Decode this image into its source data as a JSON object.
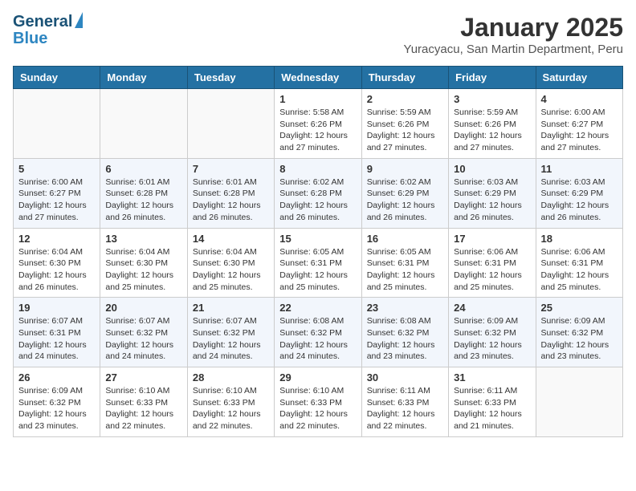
{
  "header": {
    "logo_line1": "General",
    "logo_line2": "Blue",
    "month": "January 2025",
    "location": "Yuracyacu, San Martin Department, Peru"
  },
  "weekdays": [
    "Sunday",
    "Monday",
    "Tuesday",
    "Wednesday",
    "Thursday",
    "Friday",
    "Saturday"
  ],
  "weeks": [
    [
      {
        "day": "",
        "info": ""
      },
      {
        "day": "",
        "info": ""
      },
      {
        "day": "",
        "info": ""
      },
      {
        "day": "1",
        "info": "Sunrise: 5:58 AM\nSunset: 6:26 PM\nDaylight: 12 hours\nand 27 minutes."
      },
      {
        "day": "2",
        "info": "Sunrise: 5:59 AM\nSunset: 6:26 PM\nDaylight: 12 hours\nand 27 minutes."
      },
      {
        "day": "3",
        "info": "Sunrise: 5:59 AM\nSunset: 6:26 PM\nDaylight: 12 hours\nand 27 minutes."
      },
      {
        "day": "4",
        "info": "Sunrise: 6:00 AM\nSunset: 6:27 PM\nDaylight: 12 hours\nand 27 minutes."
      }
    ],
    [
      {
        "day": "5",
        "info": "Sunrise: 6:00 AM\nSunset: 6:27 PM\nDaylight: 12 hours\nand 27 minutes."
      },
      {
        "day": "6",
        "info": "Sunrise: 6:01 AM\nSunset: 6:28 PM\nDaylight: 12 hours\nand 26 minutes."
      },
      {
        "day": "7",
        "info": "Sunrise: 6:01 AM\nSunset: 6:28 PM\nDaylight: 12 hours\nand 26 minutes."
      },
      {
        "day": "8",
        "info": "Sunrise: 6:02 AM\nSunset: 6:28 PM\nDaylight: 12 hours\nand 26 minutes."
      },
      {
        "day": "9",
        "info": "Sunrise: 6:02 AM\nSunset: 6:29 PM\nDaylight: 12 hours\nand 26 minutes."
      },
      {
        "day": "10",
        "info": "Sunrise: 6:03 AM\nSunset: 6:29 PM\nDaylight: 12 hours\nand 26 minutes."
      },
      {
        "day": "11",
        "info": "Sunrise: 6:03 AM\nSunset: 6:29 PM\nDaylight: 12 hours\nand 26 minutes."
      }
    ],
    [
      {
        "day": "12",
        "info": "Sunrise: 6:04 AM\nSunset: 6:30 PM\nDaylight: 12 hours\nand 26 minutes."
      },
      {
        "day": "13",
        "info": "Sunrise: 6:04 AM\nSunset: 6:30 PM\nDaylight: 12 hours\nand 25 minutes."
      },
      {
        "day": "14",
        "info": "Sunrise: 6:04 AM\nSunset: 6:30 PM\nDaylight: 12 hours\nand 25 minutes."
      },
      {
        "day": "15",
        "info": "Sunrise: 6:05 AM\nSunset: 6:31 PM\nDaylight: 12 hours\nand 25 minutes."
      },
      {
        "day": "16",
        "info": "Sunrise: 6:05 AM\nSunset: 6:31 PM\nDaylight: 12 hours\nand 25 minutes."
      },
      {
        "day": "17",
        "info": "Sunrise: 6:06 AM\nSunset: 6:31 PM\nDaylight: 12 hours\nand 25 minutes."
      },
      {
        "day": "18",
        "info": "Sunrise: 6:06 AM\nSunset: 6:31 PM\nDaylight: 12 hours\nand 25 minutes."
      }
    ],
    [
      {
        "day": "19",
        "info": "Sunrise: 6:07 AM\nSunset: 6:31 PM\nDaylight: 12 hours\nand 24 minutes."
      },
      {
        "day": "20",
        "info": "Sunrise: 6:07 AM\nSunset: 6:32 PM\nDaylight: 12 hours\nand 24 minutes."
      },
      {
        "day": "21",
        "info": "Sunrise: 6:07 AM\nSunset: 6:32 PM\nDaylight: 12 hours\nand 24 minutes."
      },
      {
        "day": "22",
        "info": "Sunrise: 6:08 AM\nSunset: 6:32 PM\nDaylight: 12 hours\nand 24 minutes."
      },
      {
        "day": "23",
        "info": "Sunrise: 6:08 AM\nSunset: 6:32 PM\nDaylight: 12 hours\nand 23 minutes."
      },
      {
        "day": "24",
        "info": "Sunrise: 6:09 AM\nSunset: 6:32 PM\nDaylight: 12 hours\nand 23 minutes."
      },
      {
        "day": "25",
        "info": "Sunrise: 6:09 AM\nSunset: 6:32 PM\nDaylight: 12 hours\nand 23 minutes."
      }
    ],
    [
      {
        "day": "26",
        "info": "Sunrise: 6:09 AM\nSunset: 6:32 PM\nDaylight: 12 hours\nand 23 minutes."
      },
      {
        "day": "27",
        "info": "Sunrise: 6:10 AM\nSunset: 6:33 PM\nDaylight: 12 hours\nand 22 minutes."
      },
      {
        "day": "28",
        "info": "Sunrise: 6:10 AM\nSunset: 6:33 PM\nDaylight: 12 hours\nand 22 minutes."
      },
      {
        "day": "29",
        "info": "Sunrise: 6:10 AM\nSunset: 6:33 PM\nDaylight: 12 hours\nand 22 minutes."
      },
      {
        "day": "30",
        "info": "Sunrise: 6:11 AM\nSunset: 6:33 PM\nDaylight: 12 hours\nand 22 minutes."
      },
      {
        "day": "31",
        "info": "Sunrise: 6:11 AM\nSunset: 6:33 PM\nDaylight: 12 hours\nand 21 minutes."
      },
      {
        "day": "",
        "info": ""
      }
    ]
  ]
}
